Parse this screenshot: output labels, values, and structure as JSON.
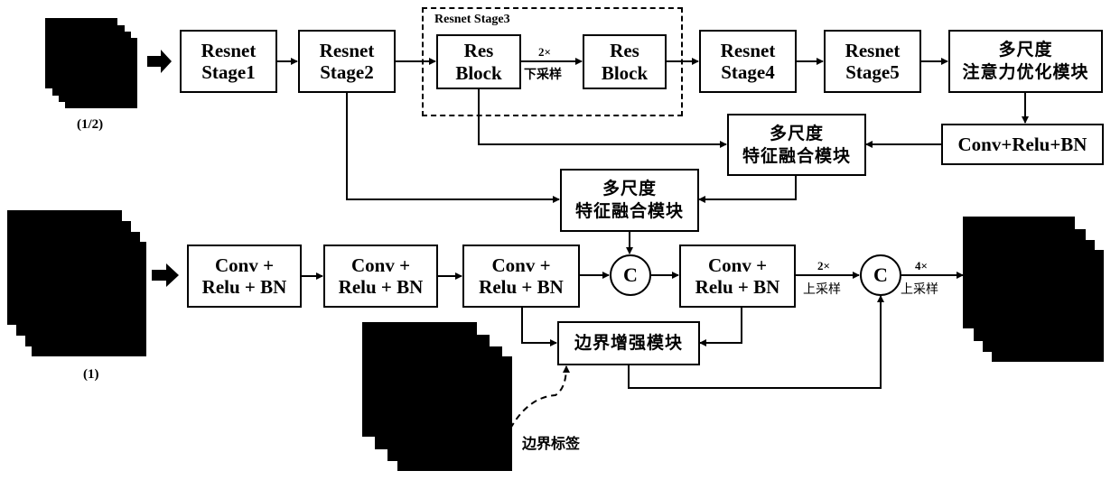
{
  "inputs": {
    "half_scale_label": "(1/2)",
    "full_scale_label": "(1)"
  },
  "encoder": {
    "stage1": [
      "Resnet",
      "Stage1"
    ],
    "stage2": [
      "Resnet",
      "Stage2"
    ],
    "stage3_group_label": "Resnet Stage3",
    "res_block_a": [
      "Res",
      "Block"
    ],
    "downsample_label": [
      "2×",
      "下采样"
    ],
    "res_block_b": [
      "Res",
      "Block"
    ],
    "stage4": [
      "Resnet",
      "Stage4"
    ],
    "stage5": [
      "Resnet",
      "Stage5"
    ],
    "attention_module": [
      "多尺度",
      "注意力优化模块"
    ],
    "conv_relu_bn": "Conv+Relu+BN"
  },
  "fusion": {
    "fusion_a": [
      "多尺度",
      "特征融合模块"
    ],
    "fusion_b": [
      "多尺度",
      "特征融合模块"
    ]
  },
  "decoder": {
    "conv1": [
      "Conv +",
      "Relu + BN"
    ],
    "conv2": [
      "Conv +",
      "Relu + BN"
    ],
    "conv3": [
      "Conv +",
      "Relu + BN"
    ],
    "concat_a": "C",
    "conv4": [
      "Conv +",
      "Relu + BN"
    ],
    "upsample_a": [
      "2×",
      "上采样"
    ],
    "concat_b": "C",
    "upsample_b": [
      "4×",
      "上采样"
    ],
    "boundary_module": "边界增强模块",
    "boundary_label": "边界标签"
  }
}
